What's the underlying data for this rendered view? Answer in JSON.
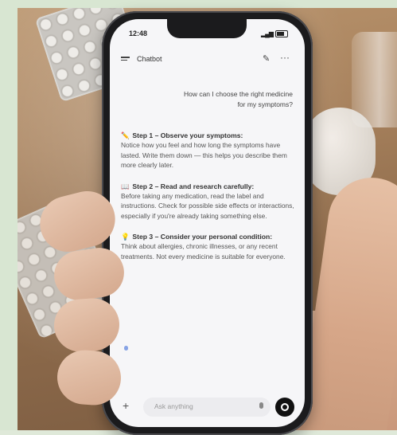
{
  "status_bar": {
    "time": "12:48"
  },
  "header": {
    "title": "Chatbot"
  },
  "conversation": {
    "user_message": "How can I choose the right medicine for my symptoms?",
    "steps": [
      {
        "emoji": "✏️",
        "title": "Step 1 – Observe your symptoms:",
        "body": "Notice how you feel and how long the symptoms have lasted. Write them down — this helps you describe them more clearly later."
      },
      {
        "emoji": "📖",
        "title": "Step 2 – Read and research carefully:",
        "body": "Before taking any medication, read the label and instructions. Check for possible side effects or interactions, especially if you're already taking something else."
      },
      {
        "emoji": "💡",
        "title": "Step 3 – Consider your personal condition:",
        "body": "Think about allergies, chronic illnesses, or any recent treatments. Not every medicine is suitable for everyone."
      }
    ]
  },
  "composer": {
    "placeholder": "Ask anything"
  }
}
